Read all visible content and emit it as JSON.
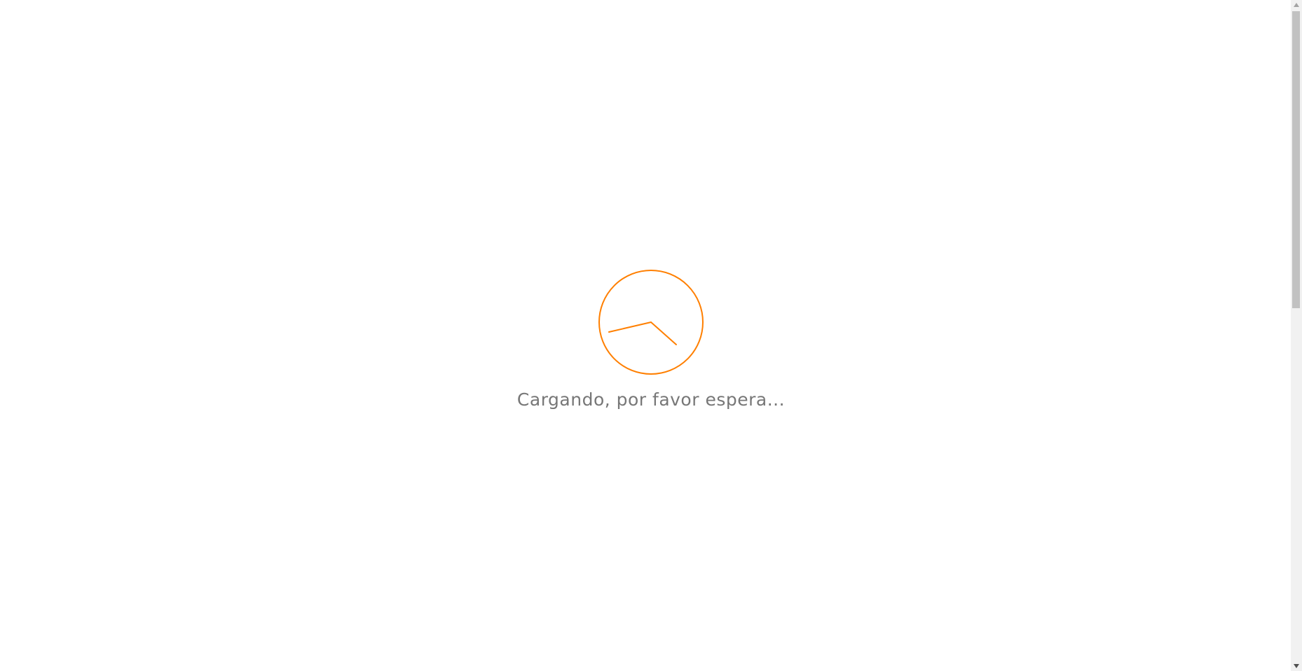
{
  "loader": {
    "message": "Cargando, por favor espera...",
    "icon": "clock-icon",
    "accent_color": "#ff7f00",
    "text_color": "#777777"
  },
  "scrollbar": {
    "up_icon": "chevron-up-icon",
    "down_icon": "chevron-down-icon"
  }
}
